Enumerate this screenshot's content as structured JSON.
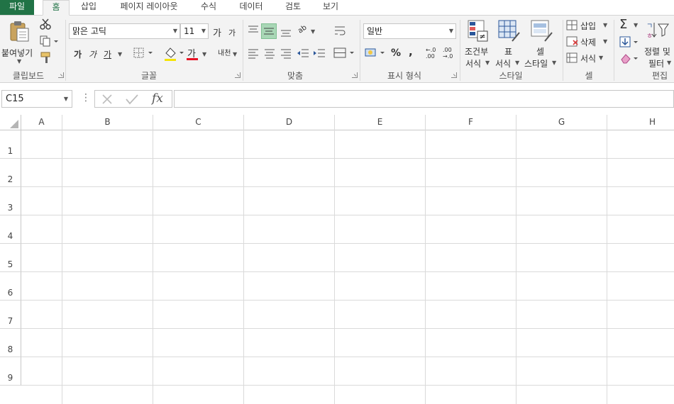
{
  "tabs": {
    "file": "파일",
    "home": "홈",
    "insert": "삽입",
    "page_layout": "페이지 레이아웃",
    "formulas": "수식",
    "data": "데이터",
    "review": "검토",
    "view": "보기"
  },
  "ribbon": {
    "clipboard": {
      "paste_label": "붙여넣기",
      "group_label": "클립보드"
    },
    "font": {
      "font_name": "맑은 고딕",
      "font_size": "11",
      "grow_glyph": "가",
      "shrink_glyph": "가",
      "bold_glyph": "가",
      "italic_glyph": "가",
      "underline_glyph": "가",
      "font_color_glyph": "가",
      "phonetic_glyph": "내천",
      "group_label": "글꼴"
    },
    "alignment": {
      "orientation_glyph": "ab",
      "group_label": "맞춤"
    },
    "number": {
      "format": "일반",
      "percent_glyph": "%",
      "comma_glyph": ",",
      "inc_decimal": "←.0 .00",
      "dec_decimal": ".00 →.0",
      "group_label": "표시 형식"
    },
    "styles": {
      "conditional_line1": "조건부",
      "conditional_line2": "서식",
      "table_line1": "표",
      "table_line2": "서식",
      "cell_line1": "셀",
      "cell_line2": "스타일",
      "group_label": "스타일"
    },
    "cells": {
      "insert": "삽입",
      "delete": "삭제",
      "format": "서식",
      "group_label": "셀"
    },
    "editing": {
      "sort_line1": "정렬 및",
      "sort_line2": "필터",
      "sum_glyph": "Σ",
      "group_label": "편집"
    }
  },
  "formula_bar": {
    "name_box": "C15",
    "fx_label": "fx",
    "formula": ""
  },
  "sheet": {
    "columns": [
      "A",
      "B",
      "C",
      "D",
      "E",
      "F",
      "G",
      "H"
    ],
    "rows": [
      "1",
      "2",
      "3",
      "4",
      "5",
      "6",
      "7",
      "8",
      "9"
    ]
  },
  "colors": {
    "accent": "#217346",
    "ribbon_bg": "#f3f3f3",
    "gridline": "#dadada",
    "font_color_bar": "#e81123",
    "selected_align": "#a9d7b6"
  }
}
